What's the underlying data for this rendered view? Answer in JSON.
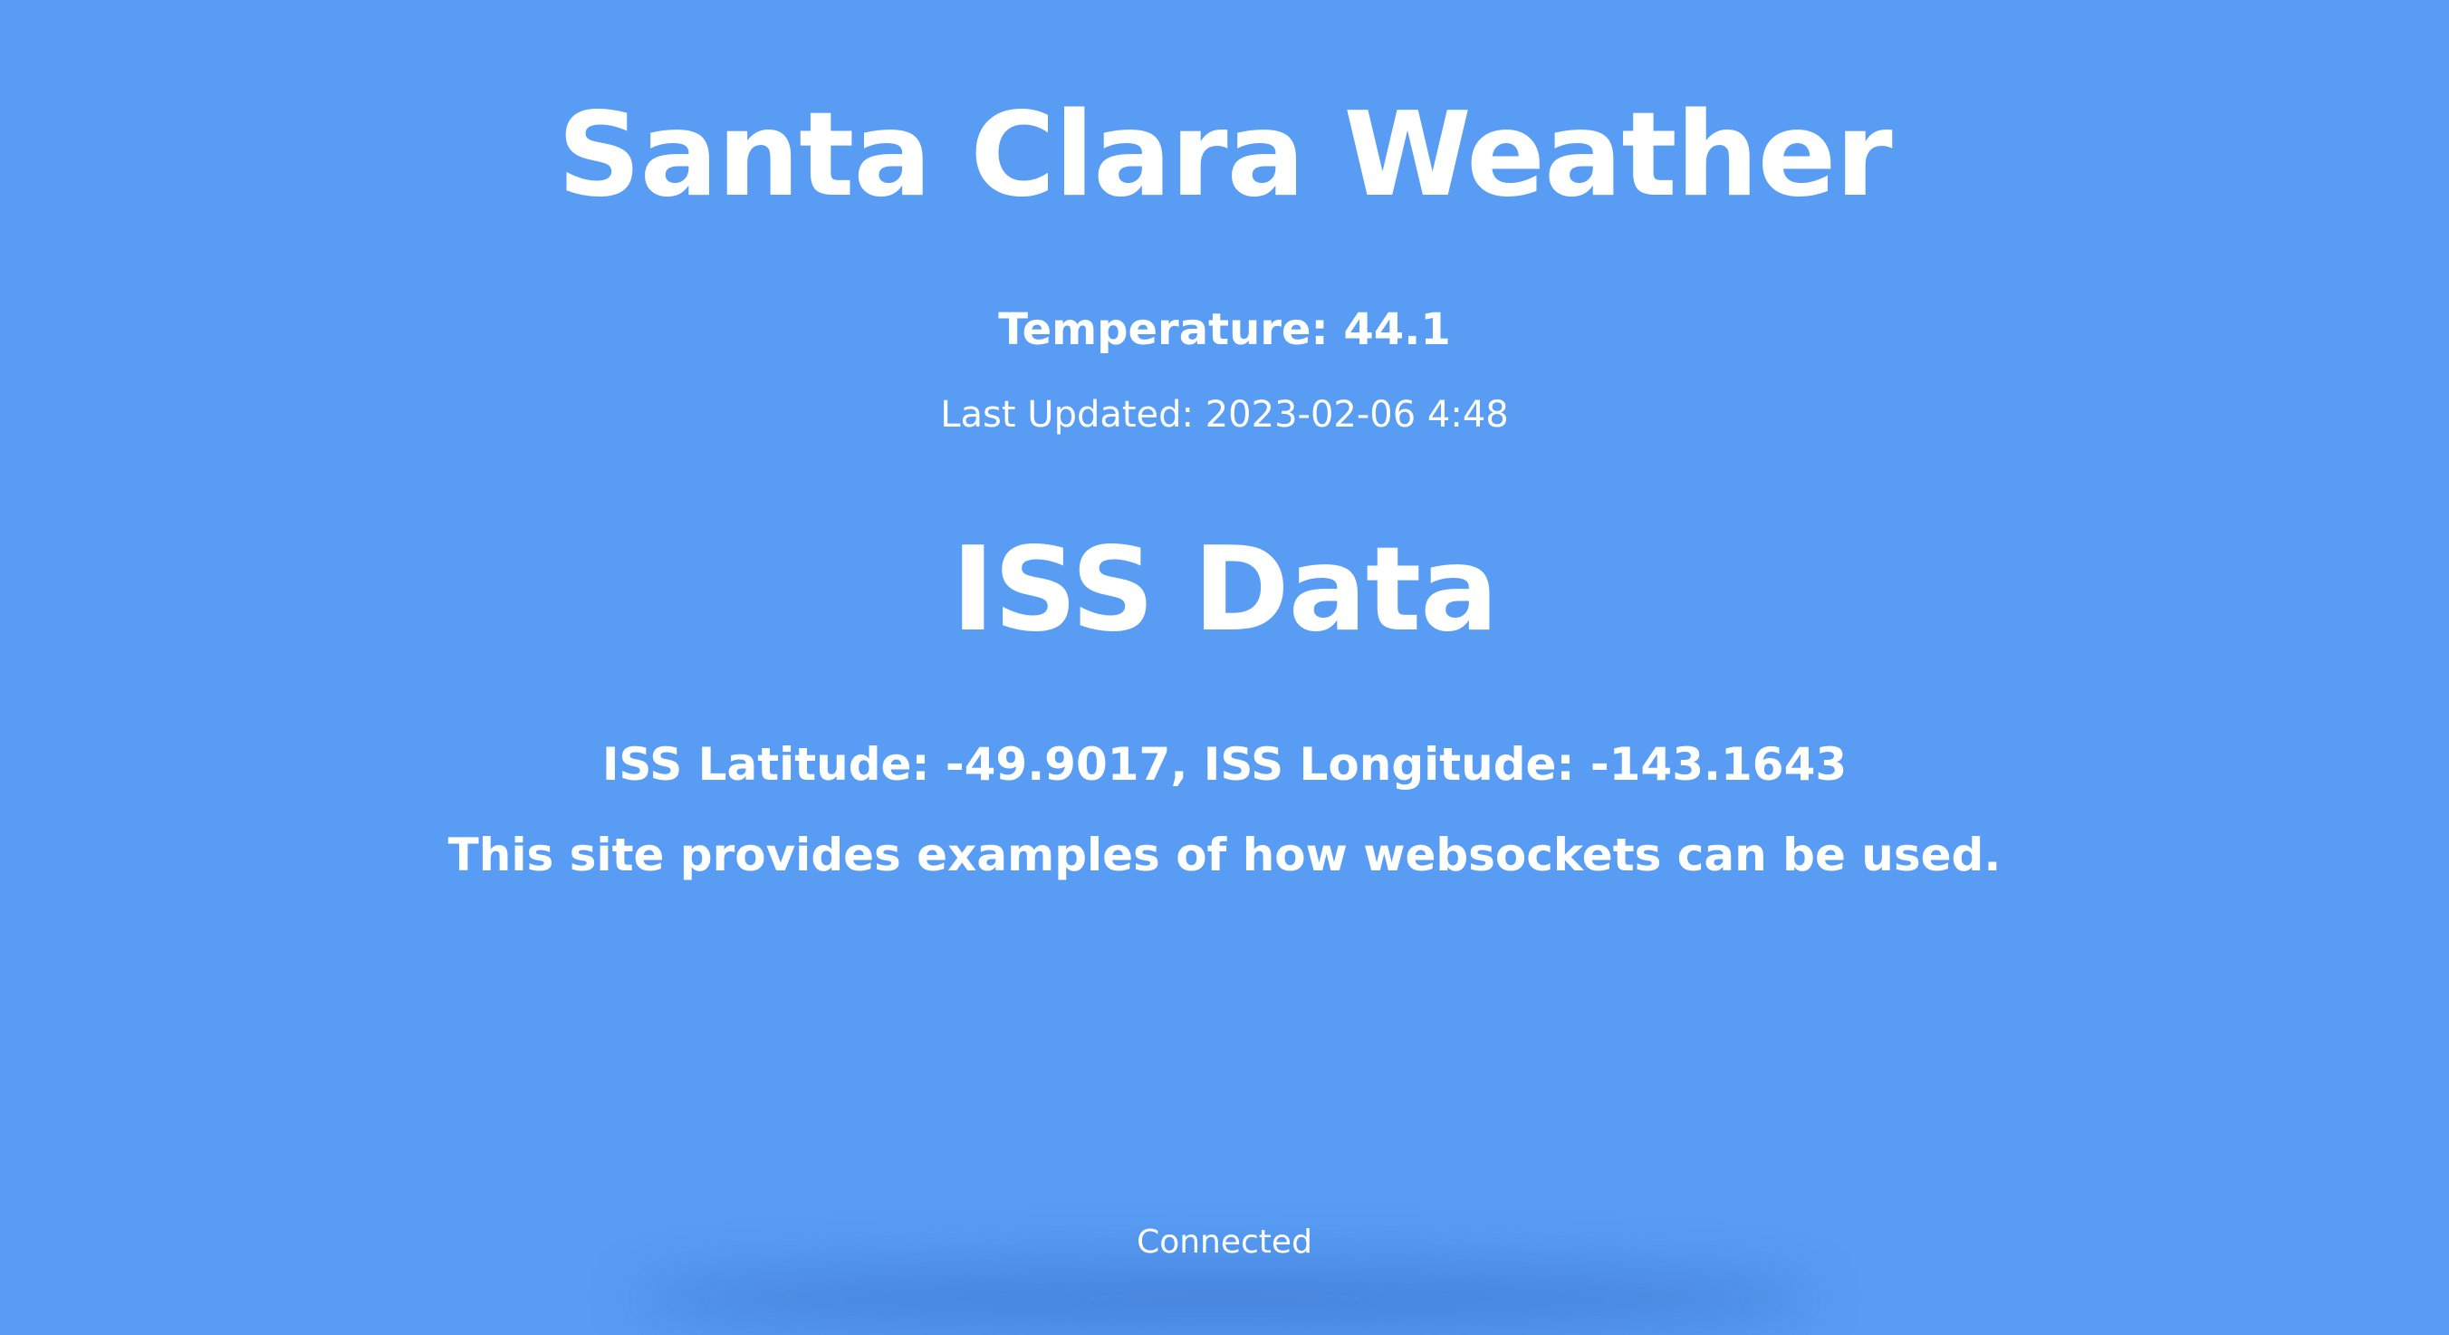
{
  "weather": {
    "title": "Santa Clara Weather",
    "temperature": "Temperature: 44.1",
    "last_updated": "Last Updated: 2023-02-06 4:48"
  },
  "iss": {
    "title": "ISS Data",
    "position": "ISS Latitude: -49.9017, ISS Longitude: -143.1643",
    "description": "This site provides examples of how websockets can be used."
  },
  "status": {
    "connection": "Connected"
  },
  "colors": {
    "background": "#589cf3",
    "text": "#ffffff"
  }
}
